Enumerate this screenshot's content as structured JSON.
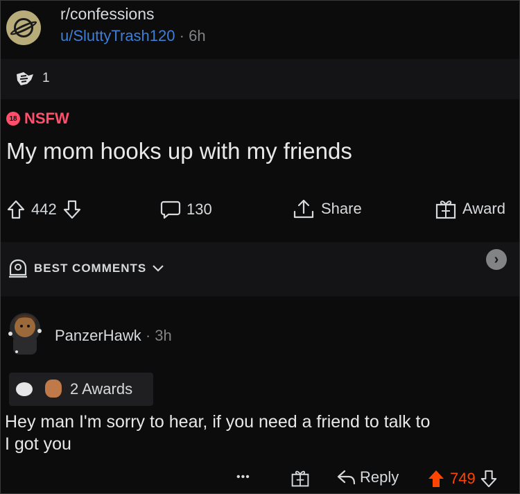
{
  "post": {
    "subreddit": "r/confessions",
    "author": "u/SluttyTrash120",
    "separator": "·",
    "time": "6h",
    "award_count": "1",
    "nsfw_badge": "18",
    "nsfw_label": "NSFW",
    "title": "My mom hooks up with my friends",
    "upvotes": "442",
    "comments": "130",
    "share_label": "Share",
    "award_label": "Award"
  },
  "comments_section": {
    "sort_label": "BEST COMMENTS"
  },
  "comment": {
    "author": "PanzerHawk",
    "separator": "·",
    "time": "3h",
    "awards_label": "2 Awards",
    "body_line1": "Hey man I'm sorry to hear, if you need a friend to talk to",
    "body_line2": "I got you",
    "more_label": "•••",
    "reply_label": "Reply",
    "score": "749"
  },
  "colors": {
    "background": "#0c0c0d",
    "accent_blue": "#3d7fd6",
    "nsfw_red": "#ff4f6b",
    "upvote_orange": "#ff4500"
  },
  "icons": [
    "subreddit-planet-icon",
    "award-icon",
    "upvote-icon",
    "downvote-icon",
    "comment-icon",
    "share-icon",
    "gift-award-icon",
    "sort-shield-icon",
    "chevron-down-icon",
    "chevron-right-icon",
    "more-icon",
    "reply-icon"
  ]
}
